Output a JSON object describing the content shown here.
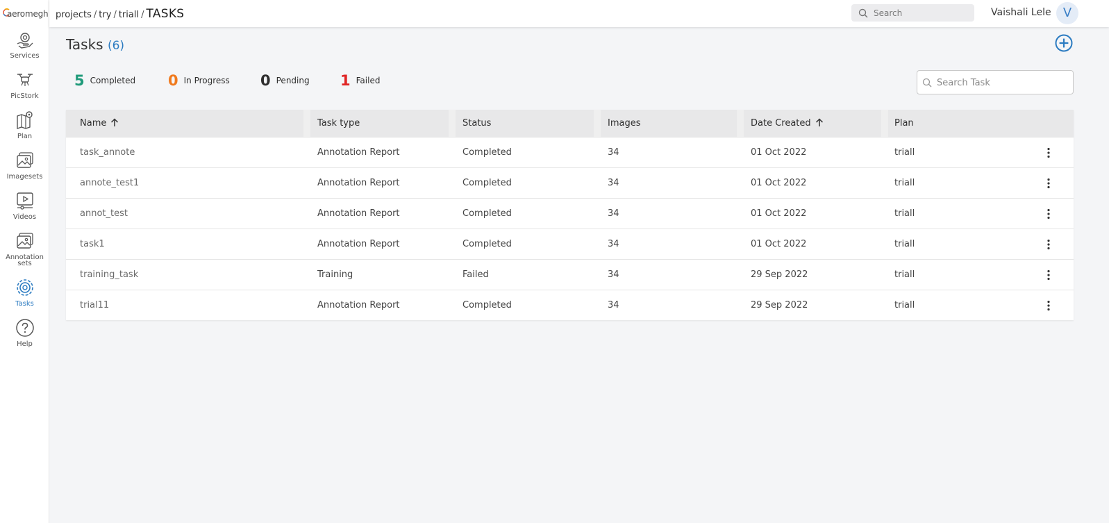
{
  "app": {
    "logo_text": "aeromegh"
  },
  "sidebar": {
    "items": [
      {
        "label": "Services",
        "icon": "services-icon"
      },
      {
        "label": "PicStork",
        "icon": "drone-icon"
      },
      {
        "label": "Plan",
        "icon": "map-pin-icon"
      },
      {
        "label": "Imagesets",
        "icon": "image-icon"
      },
      {
        "label": "Videos",
        "icon": "video-icon"
      },
      {
        "label": "Annotation sets",
        "icon": "annotation-image-icon"
      },
      {
        "label": "Tasks",
        "icon": "tasks-gear-icon",
        "active": true
      },
      {
        "label": "Help",
        "icon": "help-icon"
      }
    ]
  },
  "header": {
    "breadcrumb": {
      "projects": "projects",
      "try": "try",
      "trial": "triall",
      "current": "TASKS"
    },
    "search_placeholder": "Search",
    "user_name": "Vaishali Lele",
    "avatar_initial": "V"
  },
  "main": {
    "title": "Tasks",
    "count": "(6)",
    "stats": [
      {
        "value": "5",
        "label": "Completed",
        "color": "#1f9a7a"
      },
      {
        "value": "0",
        "label": "In Progress",
        "color": "#f07a1e"
      },
      {
        "value": "0",
        "label": "Pending",
        "color": "#2e2e2e"
      },
      {
        "value": "1",
        "label": "Failed",
        "color": "#e02424"
      }
    ],
    "task_search_placeholder": "Search Task",
    "table": {
      "columns": {
        "name": "Name",
        "task_type": "Task type",
        "status": "Status",
        "images": "Images",
        "date_created": "Date Created",
        "plan": "Plan"
      },
      "rows": [
        {
          "name": "task_annote",
          "task_type": "Annotation Report",
          "status": "Completed",
          "images": "34",
          "date": "01 Oct 2022",
          "plan": "triall"
        },
        {
          "name": "annote_test1",
          "task_type": "Annotation Report",
          "status": "Completed",
          "images": "34",
          "date": "01 Oct 2022",
          "plan": "triall"
        },
        {
          "name": "annot_test",
          "task_type": "Annotation Report",
          "status": "Completed",
          "images": "34",
          "date": "01 Oct 2022",
          "plan": "triall"
        },
        {
          "name": "task1",
          "task_type": "Annotation Report",
          "status": "Completed",
          "images": "34",
          "date": "01 Oct 2022",
          "plan": "triall"
        },
        {
          "name": "training_task",
          "task_type": "Training",
          "status": "Failed",
          "images": "34",
          "date": "29 Sep 2022",
          "plan": "triall"
        },
        {
          "name": "trial11",
          "task_type": "Annotation Report",
          "status": "Completed",
          "images": "34",
          "date": "29 Sep 2022",
          "plan": "triall"
        }
      ]
    }
  },
  "colors": {
    "accent": "#2b7bc1"
  }
}
